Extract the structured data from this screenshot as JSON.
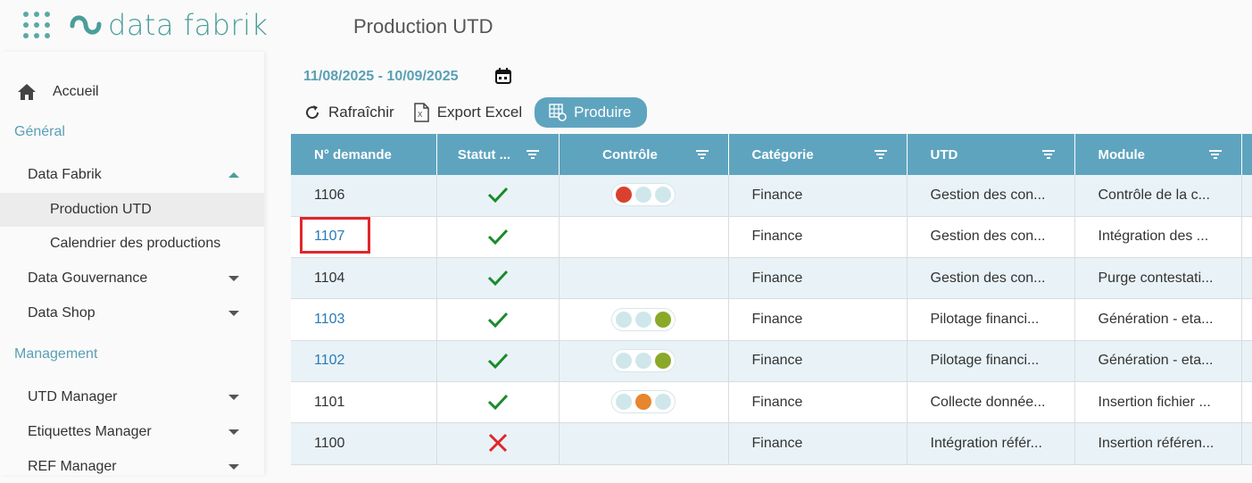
{
  "app": {
    "brand": "data fabrik",
    "page_title": "Production UTD"
  },
  "sidebar": {
    "home": "Accueil",
    "sections": [
      {
        "title": "Général"
      },
      {
        "title": "Management"
      }
    ],
    "items": [
      {
        "label": "Data Fabrik",
        "expanded": true
      },
      {
        "label": "Production UTD",
        "active": true
      },
      {
        "label": "Calendrier des productions"
      },
      {
        "label": "Data Gouvernance"
      },
      {
        "label": "Data Shop"
      },
      {
        "label": "UTD Manager"
      },
      {
        "label": "Etiquettes Manager"
      },
      {
        "label": "REF Manager"
      }
    ]
  },
  "filters": {
    "date_range": "11/08/2025 - 10/09/2025"
  },
  "toolbar": {
    "refresh": "Rafraîchir",
    "export": "Export Excel",
    "produce": "Produire"
  },
  "table": {
    "columns": [
      "N° demande",
      "Statut ...",
      "Contrôle",
      "Catégorie",
      "UTD",
      "Module"
    ],
    "rows": [
      {
        "id": "1106",
        "link": false,
        "status": "ok",
        "lights": [
          "red",
          "light",
          "light"
        ],
        "category": "Finance",
        "utd": "Gestion des con...",
        "module": "Contrôle de la c..."
      },
      {
        "id": "1107",
        "link": true,
        "status": "ok",
        "lights": [],
        "category": "Finance",
        "utd": "Gestion des con...",
        "module": "Intégration des ..."
      },
      {
        "id": "1104",
        "link": false,
        "status": "ok",
        "lights": [],
        "category": "Finance",
        "utd": "Gestion des con...",
        "module": "Purge contestati..."
      },
      {
        "id": "1103",
        "link": true,
        "status": "ok",
        "lights": [
          "light",
          "light",
          "olive"
        ],
        "category": "Finance",
        "utd": "Pilotage financi...",
        "module": "Génération - eta..."
      },
      {
        "id": "1102",
        "link": true,
        "status": "ok",
        "lights": [
          "light",
          "light",
          "olive"
        ],
        "category": "Finance",
        "utd": "Pilotage financi...",
        "module": "Génération - eta..."
      },
      {
        "id": "1101",
        "link": false,
        "status": "ok",
        "lights": [
          "light",
          "orange",
          "light"
        ],
        "category": "Finance",
        "utd": "Collecte donnée...",
        "module": "Insertion fichier ..."
      },
      {
        "id": "1100",
        "link": false,
        "status": "error",
        "lights": [],
        "category": "Finance",
        "utd": "Intégration référ...",
        "module": "Insertion référen..."
      }
    ]
  },
  "colors": {
    "accent": "#5fa4bf",
    "brand": "#4a9e9a",
    "ok": "#1a8a2a",
    "error": "#e0262b"
  }
}
